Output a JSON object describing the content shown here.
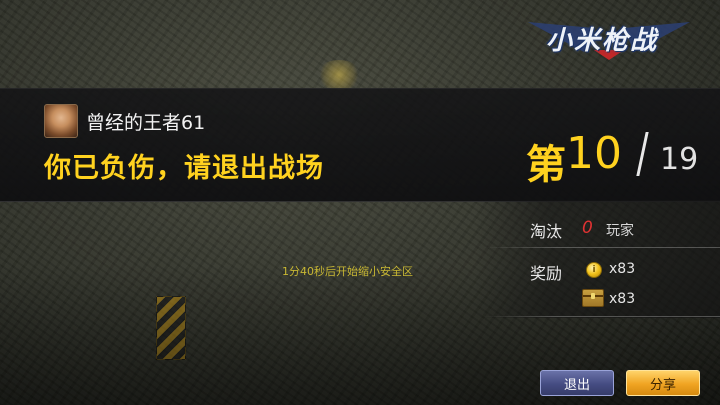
{
  "logo": {
    "text": "小米枪战"
  },
  "player": {
    "name": "曾经的王者61",
    "status_message": "你已负伤，请退出战场"
  },
  "rank": {
    "prefix": "第",
    "position": "10",
    "total": "19"
  },
  "stats": {
    "elimination_label": "淘汰",
    "elimination_count": "0",
    "elimination_unit": "玩家",
    "reward_label": "奖励",
    "coin_amount": "x83",
    "chest_amount": "x83"
  },
  "notice": {
    "safe_zone_timer": "1分40秒后开始缩小安全区"
  },
  "buttons": {
    "exit_label": "退出",
    "share_label": "分享"
  },
  "colors": {
    "accent_yellow": "#ffd21f",
    "elimination_red": "#e03232",
    "exit_button": "#454c82",
    "share_button": "#f0a422"
  }
}
